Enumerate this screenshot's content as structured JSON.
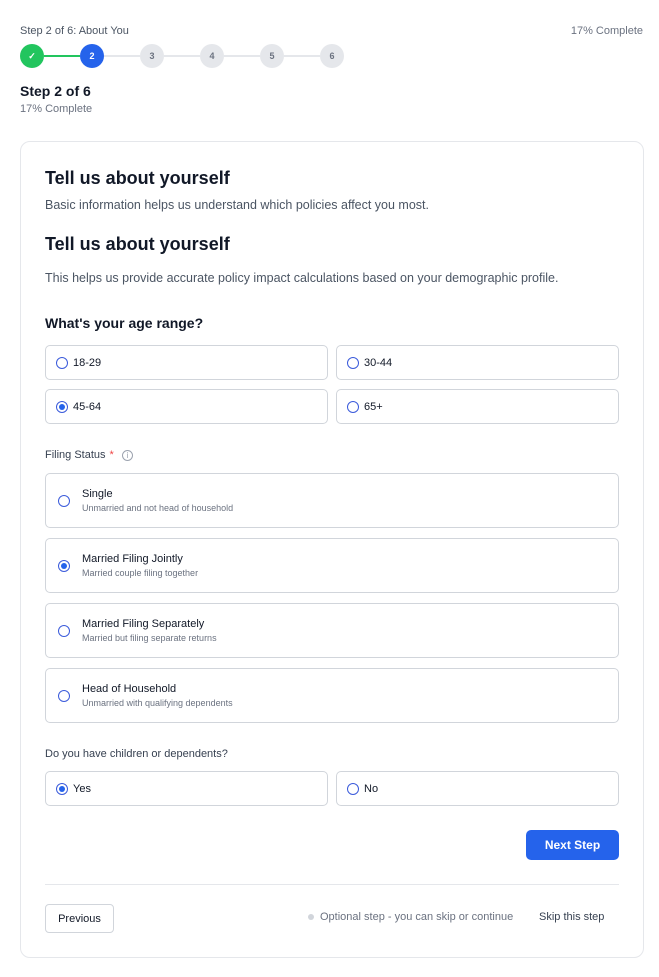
{
  "header": {
    "step_label": "Step 2 of 6: About You",
    "percent": "17% Complete",
    "title": "Step 2 of 6",
    "subtitle": "17% Complete"
  },
  "stepper": {
    "steps": [
      "✓",
      "2",
      "3",
      "4",
      "5",
      "6"
    ],
    "done_color": "#22c55e",
    "current_color": "#2563eb"
  },
  "card": {
    "heading1": "Tell us about yourself",
    "desc1": "Basic information helps us understand which policies affect you most.",
    "heading2": "Tell us about yourself",
    "desc2": "This helps us provide accurate policy impact calculations based on your demographic profile.",
    "age_question": "What's your age range?",
    "age_options": [
      {
        "label": "18-29",
        "selected": false
      },
      {
        "label": "30-44",
        "selected": false
      },
      {
        "label": "45-64",
        "selected": true
      },
      {
        "label": "65+",
        "selected": false
      }
    ],
    "filing_label": "Filing Status",
    "required_mark": "*",
    "filing_options": [
      {
        "title": "Single",
        "desc": "Unmarried and not head of household",
        "selected": false
      },
      {
        "title": "Married Filing Jointly",
        "desc": "Married couple filing together",
        "selected": true
      },
      {
        "title": "Married Filing Separately",
        "desc": "Married but filing separate returns",
        "selected": false
      },
      {
        "title": "Head of Household",
        "desc": "Unmarried with qualifying dependents",
        "selected": false
      }
    ],
    "children_question": "Do you have children or dependents?",
    "children_options": [
      {
        "label": "Yes",
        "selected": true
      },
      {
        "label": "No",
        "selected": false
      }
    ],
    "next_button": "Next Step",
    "previous_button": "Previous",
    "optional_note": "Optional step - you can skip or continue",
    "skip_link": "Skip this step"
  }
}
